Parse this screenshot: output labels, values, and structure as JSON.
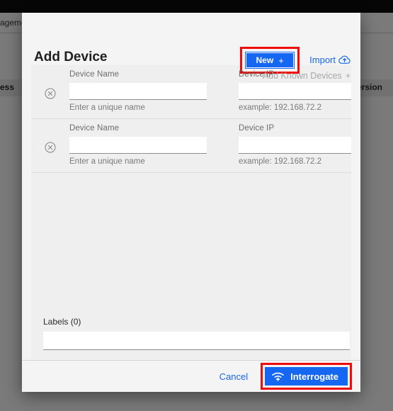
{
  "background": {
    "nav_label": "agement",
    "column_left": "ess",
    "column_right": "ersion"
  },
  "modal": {
    "title": "Add Device",
    "header": {
      "new_button": {
        "label": "New",
        "plus": "+",
        "icon": "plus-icon",
        "highlighted": true
      },
      "import_link": {
        "label": "Import",
        "icon": "cloud-upload-icon"
      },
      "add_known_devices": {
        "label": "Add Known Devices",
        "plus": "+",
        "icon": "plus-icon",
        "disabled": true
      }
    },
    "device_rows": [
      {
        "delete_icon": "circle-x-icon",
        "name": {
          "label": "Device Name",
          "value": "",
          "placeholder": "",
          "hint": "Enter a unique name"
        },
        "ip": {
          "label": "Device IP",
          "value": "",
          "placeholder": "",
          "hint": "example: 192.168.72.2",
          "icon": "rss-signal-icon"
        }
      },
      {
        "delete_icon": "circle-x-icon",
        "name": {
          "label": "Device Name",
          "value": "",
          "placeholder": "",
          "hint": "Enter a unique name"
        },
        "ip": {
          "label": "Device IP",
          "value": "",
          "placeholder": "",
          "hint": "example: 192.168.72.2",
          "icon": "rss-signal-icon"
        }
      }
    ],
    "labels": {
      "title": "Labels (0)",
      "count": 0,
      "value": "",
      "placeholder": ""
    },
    "footer": {
      "cancel_label": "Cancel",
      "interrogate_label": "Interrogate",
      "interrogate_icon": "wifi-icon",
      "interrogate_highlighted": true
    }
  },
  "colors": {
    "accent_blue": "#1566f0",
    "highlight_red": "#f00a0a",
    "modal_bg": "#f4f4f4",
    "body_bg": "#efefef",
    "muted_text": "#7a7a7a",
    "label_text": "#6d6d6d"
  }
}
